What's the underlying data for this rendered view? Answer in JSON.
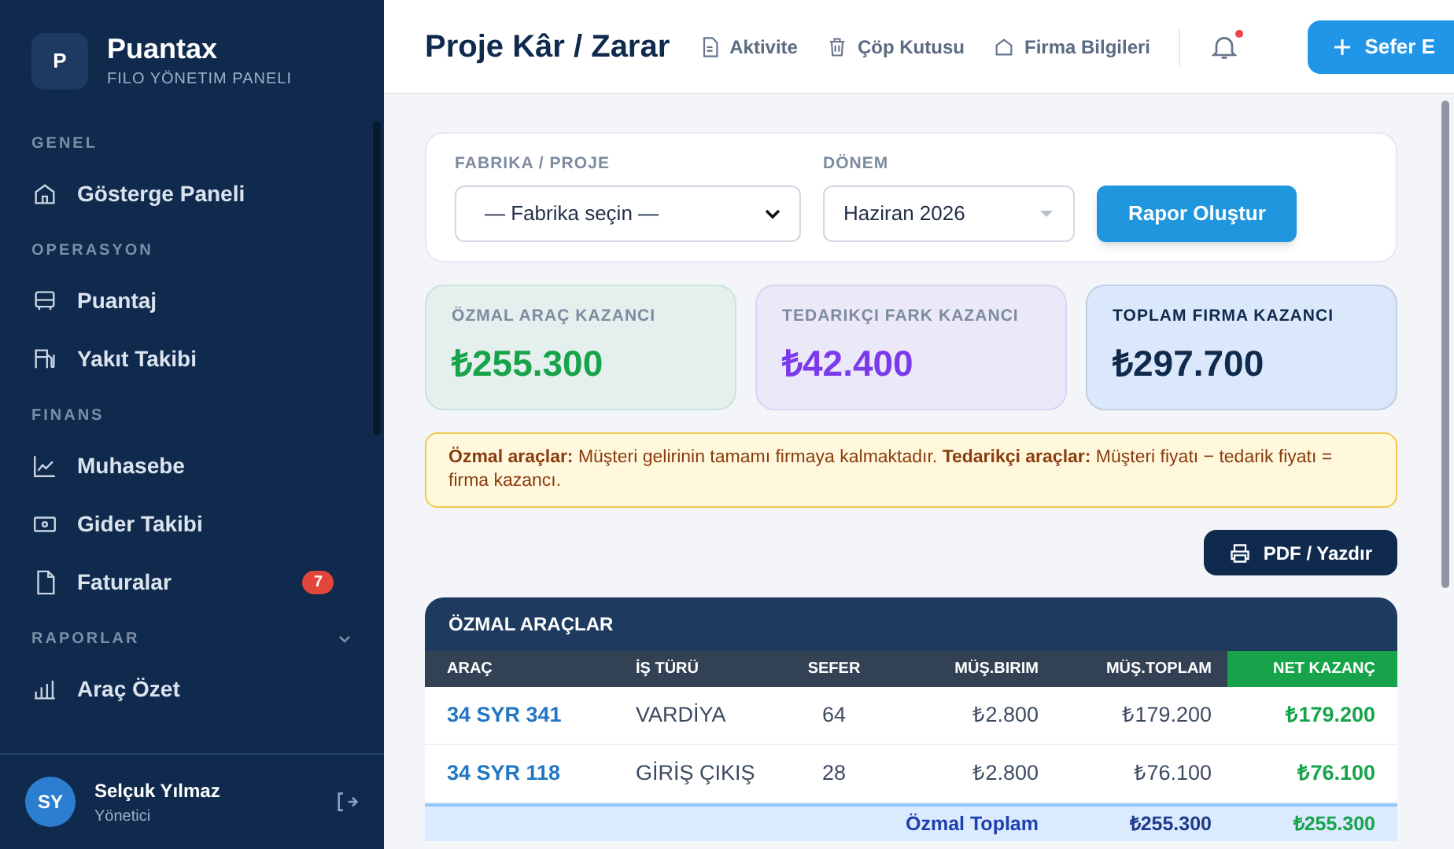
{
  "sidebar": {
    "brand": {
      "logo_letter": "P",
      "name": "Puantax",
      "subtitle": "FILO YÖNETIM PANELI"
    },
    "sections": [
      {
        "title": "GENEL",
        "items": [
          {
            "label": "Gösterge Paneli"
          }
        ]
      },
      {
        "title": "OPERASYON",
        "items": [
          {
            "label": "Puantaj"
          },
          {
            "label": "Yakıt Takibi"
          }
        ]
      },
      {
        "title": "FINANS",
        "items": [
          {
            "label": "Muhasebe"
          },
          {
            "label": "Gider Takibi"
          },
          {
            "label": "Faturalar",
            "badge": "7"
          }
        ]
      },
      {
        "title": "RAPORLAR",
        "expanded": true,
        "items": [
          {
            "label": "Araç Özet"
          }
        ]
      }
    ],
    "user": {
      "initials": "SY",
      "name": "Selçuk Yılmaz",
      "role": "Yönetici"
    }
  },
  "header": {
    "title": "Proje Kâr / Zarar",
    "links": [
      "Aktivite",
      "Çöp Kutusu",
      "Firma Bilgileri"
    ],
    "notification": {
      "unread": true
    },
    "primary_button": "Sefer E"
  },
  "filters": {
    "fields": [
      {
        "label": "FABRIKA / PROJE",
        "value": "— Fabrika seçin —",
        "kind": "native"
      },
      {
        "label": "DÖNEM",
        "value": "Haziran 2026",
        "kind": "custom"
      }
    ],
    "button": "Rapor Oluştur"
  },
  "stats": [
    {
      "label": "ÖZMAL ARAÇ KAZANCI",
      "value": "₺255.300",
      "color": "#16a34a"
    },
    {
      "label": "TEDARIKÇI FARK KAZANCI",
      "value": "₺42.400",
      "color": "#7c3aed"
    },
    {
      "label": "TOPLAM FIRMA KAZANCI",
      "value": "₺297.700",
      "color": "#0f2a4d"
    }
  ],
  "notice": "**Özmal araçlar:** Müşteri gelirinin tamamı firmaya kalmaktadır.   **Tedarikçi araçlar:** Müşteri fiyatı − tedarik fiyatı = firma kazancı.",
  "print_button": "PDF / Yazdır",
  "table": {
    "title": "ÖZMAL ARAÇLAR",
    "columns": [
      "ARAÇ",
      "İŞ TÜRÜ",
      "SEFER",
      "MÜŞ.BIRIM",
      "MÜŞ.TOPLAM",
      "NET KAZANÇ"
    ],
    "rows": [
      [
        "34 SYR 341",
        "VARDİYA",
        "64",
        "₺2.800",
        "₺179.200",
        "₺179.200"
      ],
      [
        "34 SYR 118",
        "GİRİŞ ÇIKIŞ",
        "28",
        "₺2.800",
        "₺76.100",
        "₺76.100"
      ]
    ],
    "total": {
      "label": "Özmal Toplam",
      "customer_total": "₺255.300",
      "net": "₺255.300"
    }
  }
}
